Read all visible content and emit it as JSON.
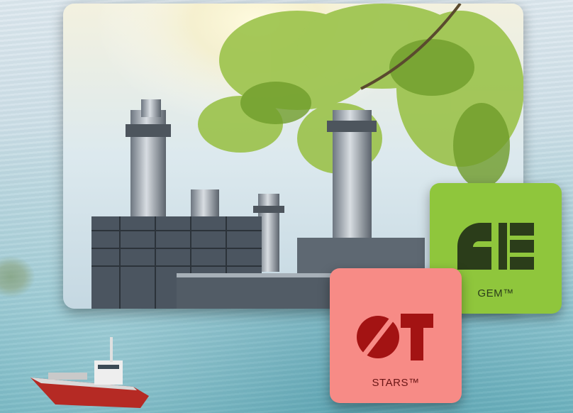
{
  "tiles": {
    "gem": {
      "label": "GEM™",
      "color": "#8fc63c"
    },
    "stars": {
      "label": "STARS™",
      "color": "#f78b86"
    }
  }
}
